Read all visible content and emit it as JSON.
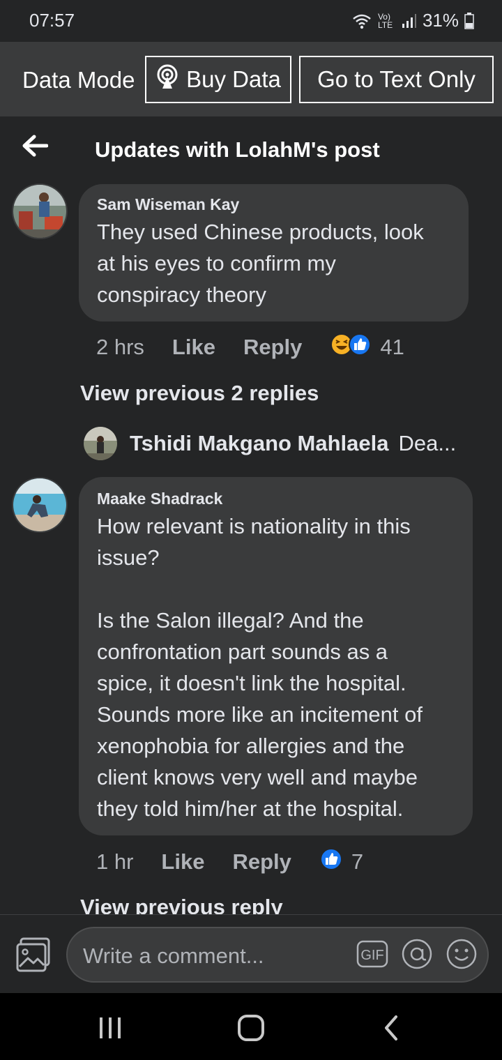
{
  "status_bar": {
    "time": "07:57",
    "network": "Vo) LTE",
    "battery": "31%"
  },
  "data_bar": {
    "mode_label": "Data Mode",
    "buy_label": "Buy Data",
    "text_only_label": "Go to Text Only"
  },
  "header": {
    "title": "Updates with LolahM's post"
  },
  "comments": [
    {
      "author": "Sam Wiseman Kay",
      "text": "They used Chinese products, look\nat his eyes to confirm my\nconspiracy theory",
      "time": "2 hrs",
      "like": "Like",
      "reply": "Reply",
      "reactions": [
        "haha-icon",
        "like-icon"
      ],
      "count": "41"
    },
    {
      "author": "Maake Shadrack",
      "text": "How relevant is nationality in this\nissue?\n\nIs the Salon illegal? And the\nconfrontation part sounds as a\nspice, it doesn't link the hospital.\nSounds more like an incitement of\nxenophobia for allergies and the\nclient knows very well and maybe\nthey told him/her at the hospital.",
      "time": "1 hr",
      "like": "Like",
      "reply": "Reply",
      "reactions": [
        "like-icon"
      ],
      "count": "7"
    }
  ],
  "view_previous_replies": "View previous 2 replies",
  "reply_preview": {
    "name": "Tshidi Makgano Mahlaela",
    "snippet": "Dea..."
  },
  "view_previous_reply": "View previous reply",
  "composer": {
    "placeholder": "Write a comment...",
    "gif_label": "GIF"
  },
  "colors": {
    "background": "#242526",
    "bubble": "#3a3b3c",
    "like_blue": "#1877f2",
    "haha_yellow": "#f7b125"
  }
}
